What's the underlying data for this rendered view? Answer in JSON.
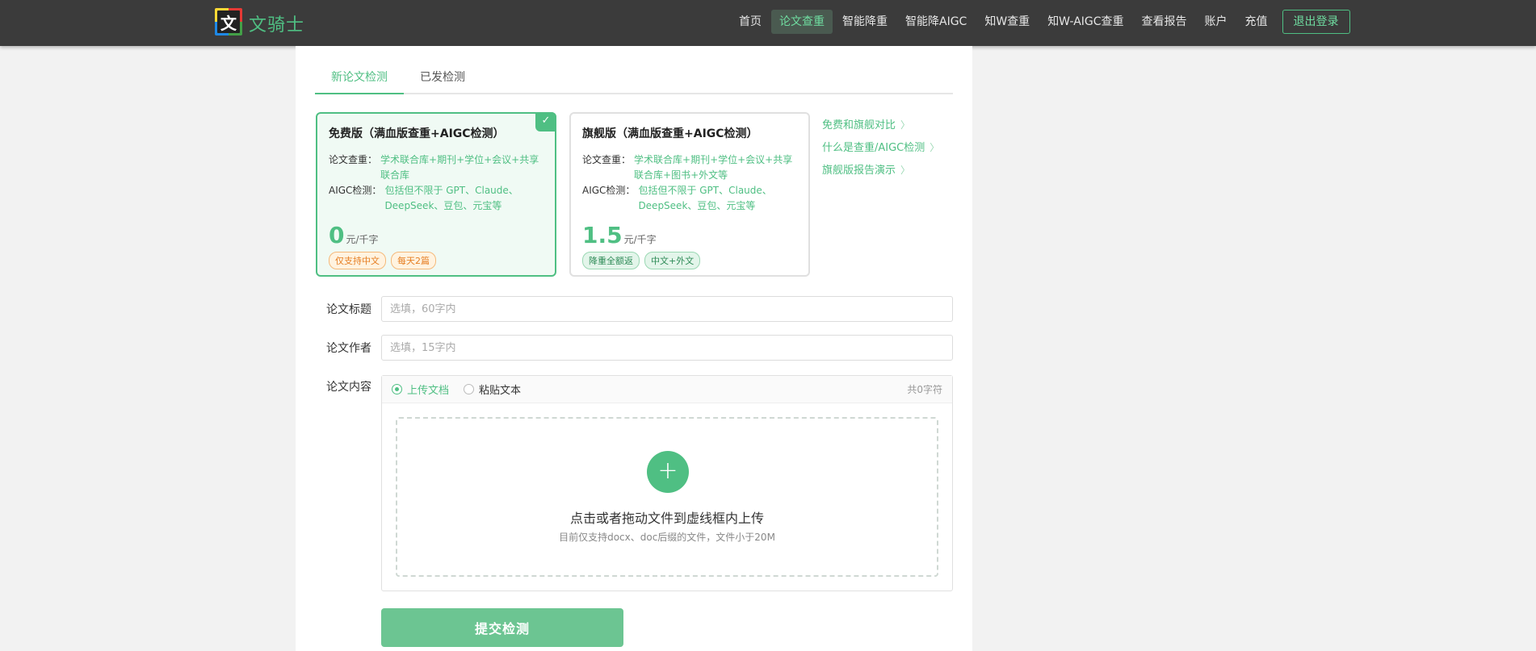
{
  "brand": {
    "logo_char": "文",
    "name": "文骑士"
  },
  "nav": {
    "items": [
      "首页",
      "论文查重",
      "智能降重",
      "智能降AIGC",
      "知W查重",
      "知W-AIGC查重",
      "查看报告",
      "账户",
      "充值"
    ],
    "logout": "退出登录"
  },
  "tabs": {
    "new": "新论文检测",
    "published": "已发检测"
  },
  "plans": {
    "free": {
      "title": "免费版（满血版查重+AIGC检测）",
      "check_label": "论文查重：",
      "check_value": "学术联合库+期刊+学位+会议+共享联合库",
      "aigc_label": "AIGC检测：",
      "aigc_value": "包括但不限于 GPT、Claude、DeepSeek、豆包、元宝等",
      "price": "0",
      "unit": "元/千字",
      "tag1": "仅支持中文",
      "tag2": "每天2篇"
    },
    "flagship": {
      "title": "旗舰版（满血版查重+AIGC检测）",
      "check_label": "论文查重：",
      "check_value": "学术联合库+期刊+学位+会议+共享联合库+图书+外文等",
      "aigc_label": "AIGC检测：",
      "aigc_value": "包括但不限于 GPT、Claude、DeepSeek、豆包、元宝等",
      "price": "1.5",
      "unit": "元/千字",
      "tag1": "降重全额返",
      "tag2": "中文+外文"
    }
  },
  "side_links": [
    "免费和旗舰对比",
    "什么是查重/AIGC检测",
    "旗舰版报告演示"
  ],
  "form": {
    "title_label": "论文标题",
    "title_placeholder": "选填，60字内",
    "author_label": "论文作者",
    "author_placeholder": "选填，15字内",
    "content_label": "论文内容",
    "radio_upload": "上传文档",
    "radio_paste": "粘贴文本",
    "counter": "共0字符",
    "drop_main": "点击或者拖动文件到虚线框内上传",
    "drop_sub": "目前仅支持docx、doc后缀的文件，文件小于20M",
    "submit": "提交检测"
  },
  "colors": {
    "accent": "#4fbf83",
    "topbar": "#3b3b3b",
    "submit": "#6cc592"
  }
}
